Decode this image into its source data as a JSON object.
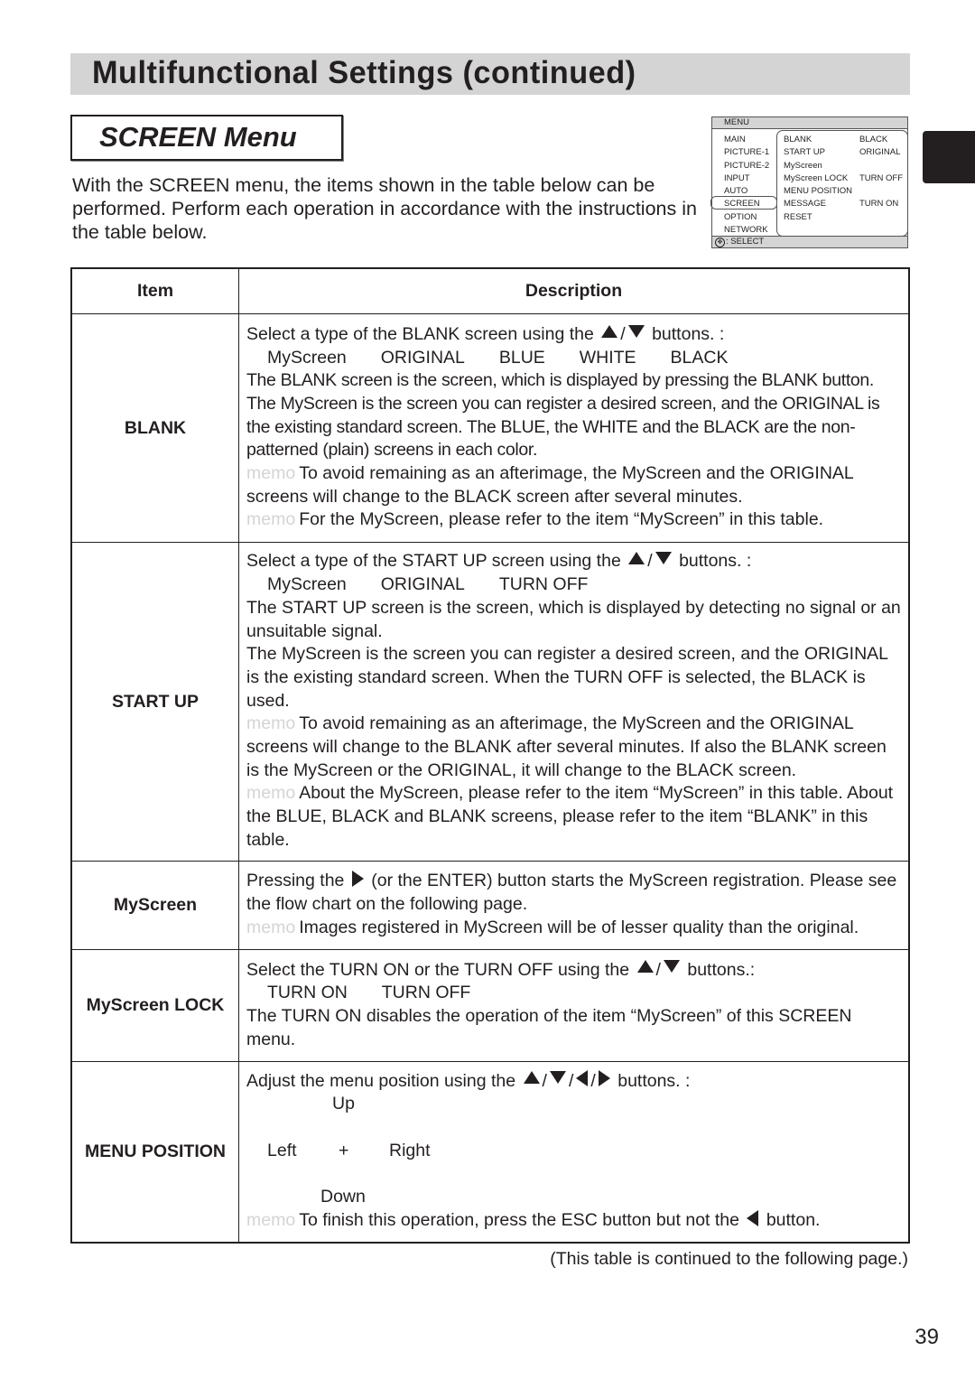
{
  "header": {
    "title": "Multifunctional Settings (continued)",
    "section": "SCREEN Menu",
    "intro": "With the SCREEN menu, the items shown in the table below can be performed. Perform each operation in accordance with the instructions in the table below."
  },
  "osd_menu": {
    "header": "MENU",
    "left_items": [
      "MAIN",
      "PICTURE-1",
      "PICTURE-2",
      "INPUT",
      "AUTO",
      "SCREEN",
      "OPTION",
      "NETWORK"
    ],
    "selected": "SCREEN",
    "right_items": [
      "BLANK",
      "START UP",
      "MyScreen",
      "MyScreen LOCK",
      "MENU POSITION",
      "MESSAGE",
      "RESET"
    ],
    "right_values": [
      "BLACK",
      "ORIGINAL",
      "",
      "TURN OFF",
      "",
      "TURN ON",
      ""
    ],
    "footer": ": SELECT"
  },
  "table": {
    "headers": {
      "item": "Item",
      "description": "Description"
    },
    "memo_label": "memo",
    "rows": {
      "blank": {
        "item": "BLANK",
        "intro_pre": "Select a type of the BLANK screen using the",
        "intro_sep": "/",
        "intro_post": "buttons. :",
        "options": [
          "MyScreen",
          "ORIGINAL",
          "BLUE",
          "WHITE",
          "BLACK"
        ],
        "body": "The BLANK screen is the screen, which is displayed by pressing the BLANK button. The MyScreen is the screen you can register a desired screen, and the ORIGINAL is the existing standard screen. The BLUE, the WHITE and the BLACK are the non-patterned (plain) screens in each color.",
        "memo1": "To avoid remaining as an afterimage, the MyScreen and the ORIGINAL screens will change to the BLACK screen after several minutes.",
        "memo2": "For the MyScreen, please refer to the item “MyScreen” in this table."
      },
      "startup": {
        "item": "START UP",
        "intro_pre": "Select a type of the START UP screen using the",
        "intro_sep": "/",
        "intro_post": "buttons. :",
        "options": [
          "MyScreen",
          "ORIGINAL",
          "TURN OFF"
        ],
        "body1": "The START UP screen is the screen, which is displayed by detecting no signal or an unsuitable signal.",
        "body2": "The MyScreen is the screen you can register a desired screen, and the ORIGINAL is the existing standard screen. When the TURN OFF is selected, the BLACK is used.",
        "memo1": "To avoid remaining as an afterimage, the MyScreen and the ORIGINAL screens will change to the BLANK after several minutes. If also the BLANK screen is the MyScreen or the ORIGINAL, it will change to the BLACK screen.",
        "memo2": "About the MyScreen, please refer to the item “MyScreen” in this table. About the BLUE, BLACK and BLANK screens, please refer to the item “BLANK” in this table."
      },
      "myscreen": {
        "item": "MyScreen",
        "body_pre": "Pressing the",
        "body_post": "(or the ENTER) button starts the MyScreen registration. Please see the flow chart on the following page.",
        "memo1": "Images registered in MyScreen will be of lesser quality than the original."
      },
      "lock": {
        "item": "MyScreen LOCK",
        "intro_pre": "Select the TURN ON or the TURN OFF using the",
        "intro_sep": "/",
        "intro_post": "buttons.:",
        "options": [
          "TURN ON",
          "TURN OFF"
        ],
        "body": "The TURN ON disables the operation of the item “MyScreen” of this SCREEN menu."
      },
      "position": {
        "item": "MENU POSITION",
        "intro_pre": "Adjust the menu position using the",
        "intro_sep": "/",
        "intro_post": "buttons. :",
        "up": "Up",
        "left": "Left",
        "center": "+",
        "right": "Right",
        "down": "Down",
        "memo_pre": "To finish this operation, press the ESC button but not the",
        "memo_post": "button."
      }
    }
  },
  "footer": {
    "note": "(This table is continued to the following page.)",
    "page_number": "39"
  }
}
